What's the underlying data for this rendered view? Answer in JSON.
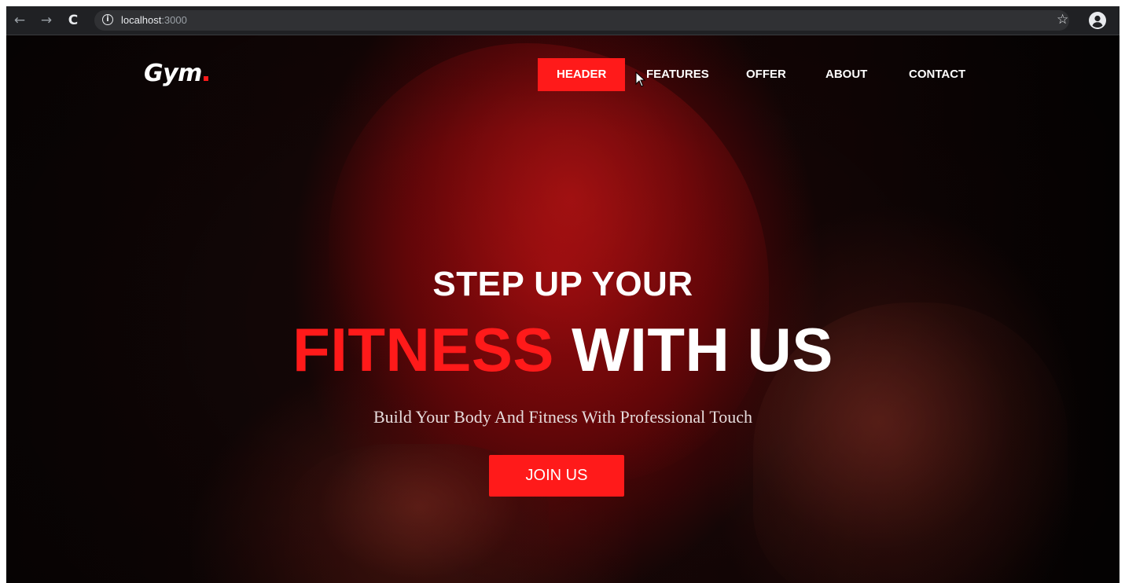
{
  "browser": {
    "back_icon": "arrow-left-icon",
    "forward_icon": "arrow-right-icon",
    "reload_icon": "reload-icon",
    "url_host": "localhost",
    "url_port": ":3000",
    "bookmark_icon": "star-icon",
    "profile_icon": "account-circle-icon"
  },
  "header": {
    "logo_text": "Gym",
    "nav": {
      "header": "HEADER",
      "features": "FEATURES",
      "offer": "OFFER",
      "about": "ABOUT",
      "contact": "CONTACT"
    },
    "active_item": "HEADER"
  },
  "hero": {
    "line1": "STEP UP YOUR",
    "line2_red": "FITNESS",
    "line2_white": "WITH US",
    "tagline": "Build Your Body And Fitness With Professional Touch",
    "cta_label": "JOIN US"
  },
  "colors": {
    "accent": "#ff1a1a",
    "text": "#ffffff",
    "browser_bar": "#202124"
  }
}
